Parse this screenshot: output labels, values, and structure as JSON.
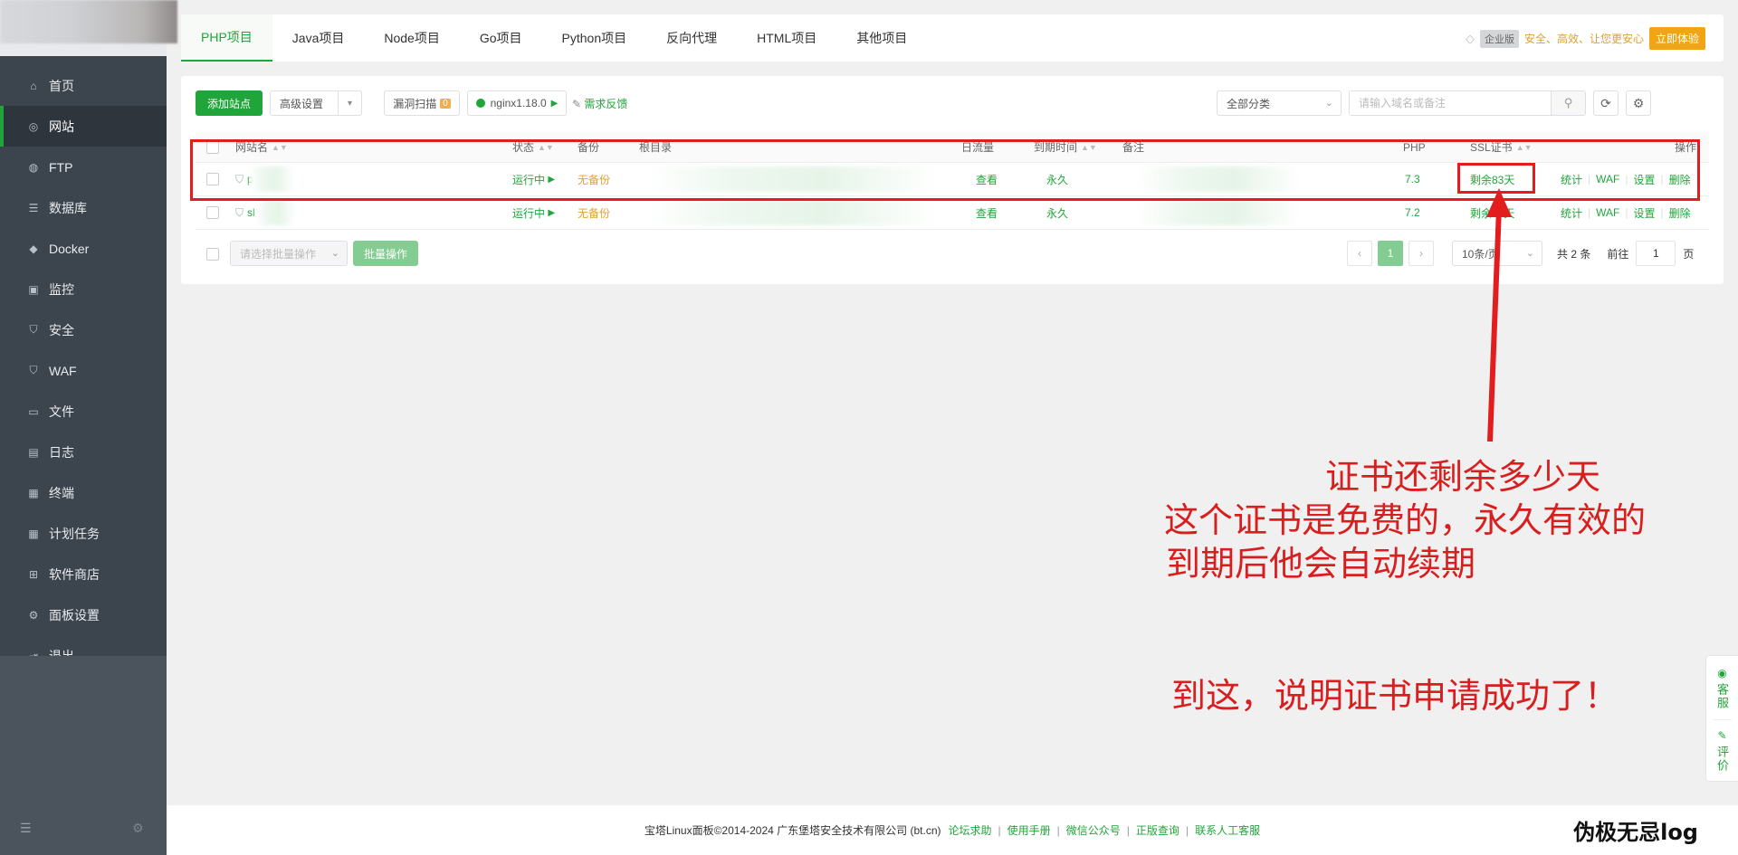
{
  "sidebar": {
    "items": [
      {
        "label": "首页",
        "icon": "home-icon"
      },
      {
        "label": "网站",
        "icon": "globe-icon",
        "active": true
      },
      {
        "label": "FTP",
        "icon": "ftp-icon"
      },
      {
        "label": "数据库",
        "icon": "database-icon"
      },
      {
        "label": "Docker",
        "icon": "docker-icon"
      },
      {
        "label": "监控",
        "icon": "monitor-icon"
      },
      {
        "label": "安全",
        "icon": "shield-icon"
      },
      {
        "label": "WAF",
        "icon": "waf-icon"
      },
      {
        "label": "文件",
        "icon": "folder-icon"
      },
      {
        "label": "日志",
        "icon": "log-icon"
      },
      {
        "label": "终端",
        "icon": "terminal-icon"
      },
      {
        "label": "计划任务",
        "icon": "calendar-icon"
      },
      {
        "label": "软件商店",
        "icon": "store-icon"
      },
      {
        "label": "面板设置",
        "icon": "settings-icon"
      },
      {
        "label": "退出",
        "icon": "logout-icon"
      }
    ]
  },
  "tabs": [
    "PHP项目",
    "Java项目",
    "Node项目",
    "Go项目",
    "Python项目",
    "反向代理",
    "HTML项目",
    "其他项目"
  ],
  "promo": {
    "edition": "企业版",
    "slogan": "安全、高效、让您更安心",
    "button": "立即体验"
  },
  "toolbar": {
    "add_site": "添加站点",
    "advanced": "高级设置",
    "vuln_scan": "漏洞扫描",
    "vuln_count": "0",
    "nginx": "nginx1.18.0",
    "feedback": "需求反馈",
    "category": "全部分类",
    "search_placeholder": "请输入域名或备注"
  },
  "table": {
    "headers": {
      "name": "网站名",
      "status": "状态",
      "backup": "备份",
      "root": "根目录",
      "traffic": "日流量",
      "expire": "到期时间",
      "note": "备注",
      "php": "PHP",
      "ssl": "SSL证书",
      "ops": "操作"
    },
    "rows": [
      {
        "name": "p",
        "status": "运行中",
        "backup": "无备份",
        "traffic": "查看",
        "expire": "永久",
        "php": "7.3",
        "ssl": "剩余83天"
      },
      {
        "name": "sl",
        "status": "运行中",
        "backup": "无备份",
        "traffic": "查看",
        "expire": "永久",
        "php": "7.2",
        "ssl": "剩余83天"
      }
    ],
    "ops": [
      "统计",
      "WAF",
      "设置",
      "删除"
    ]
  },
  "batch": {
    "select_placeholder": "请选择批量操作",
    "button": "批量操作"
  },
  "pagination": {
    "current": "1",
    "page_size": "10条/页",
    "total": "共 2 条",
    "goto_label": "前往",
    "goto_value": "1",
    "page_suffix": "页"
  },
  "annotations": {
    "line1": "证书还剩余多少天",
    "line2": "这个证书是免费的，永久有效的",
    "line3": "到期后他会自动续期",
    "line4": "到这，说明证书申请成功了！"
  },
  "float_panel": {
    "service": "客服",
    "review": "评价"
  },
  "footer": {
    "copyright": "宝塔Linux面板©2014-2024 广东堡塔安全技术有限公司 (bt.cn)",
    "links": [
      "论坛求助",
      "使用手册",
      "微信公众号",
      "正版查询",
      "联系人工客服"
    ]
  },
  "watermark": "伪极无忌log",
  "colors": {
    "brand": "#20a53a",
    "annotation": "#e31d1d",
    "sidebar": "#3c444d"
  }
}
